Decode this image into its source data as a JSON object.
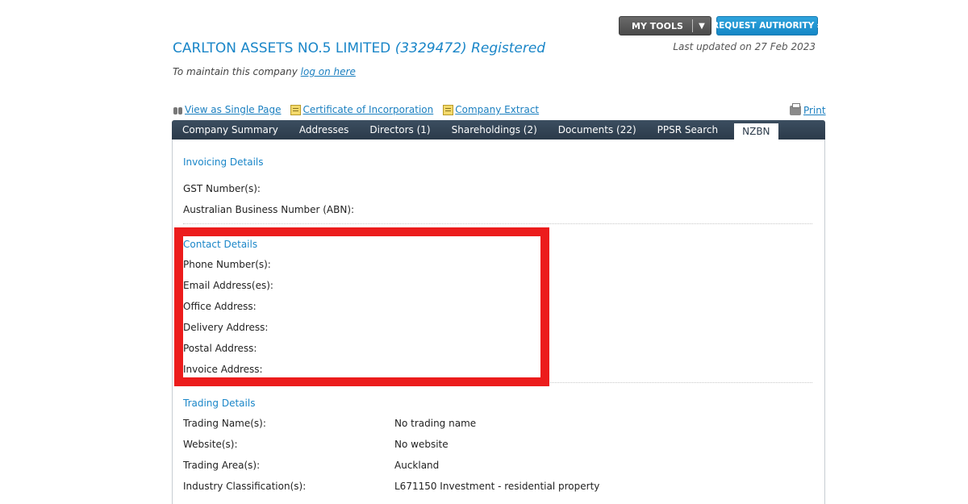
{
  "top_buttons": {
    "my_tools": "MY TOOLS",
    "dropdown_glyph": "▼",
    "request_authority": "REQUEST AUTHORITY",
    "request_chevron": "»"
  },
  "company": {
    "name": "CARLTON ASSETS NO.5 LIMITED",
    "number": "(3329472)",
    "status": "Registered",
    "last_updated": "Last updated on 27 Feb 2023",
    "maintain_text": "To maintain this company",
    "logon_link": "log on here"
  },
  "links": {
    "single_page": "View as Single Page",
    "certificate": "Certificate of Incorporation",
    "extract": "Company Extract",
    "print": "Print"
  },
  "tabs": [
    {
      "label": "Company Summary"
    },
    {
      "label": "Addresses"
    },
    {
      "label": "Directors (1)"
    },
    {
      "label": "Shareholdings (2)"
    },
    {
      "label": "Documents (22)"
    },
    {
      "label": "PPSR Search"
    },
    {
      "label": "NZBN",
      "active": true
    }
  ],
  "invoicing": {
    "heading": "Invoicing Details",
    "gst": "GST Number(s):",
    "abn": "Australian Business Number (ABN):"
  },
  "contact": {
    "heading": "Contact Details",
    "phone": "Phone Number(s):",
    "email": "Email Address(es):",
    "office": "Office Address:",
    "delivery": "Delivery Address:",
    "postal": "Postal Address:",
    "invoice": "Invoice Address:"
  },
  "trading": {
    "heading": "Trading Details",
    "rows": [
      {
        "label": "Trading Name(s):",
        "value": "No trading name"
      },
      {
        "label": "Website(s):",
        "value": "No website"
      },
      {
        "label": "Trading Area(s):",
        "value": "Auckland"
      },
      {
        "label": "Industry Classification(s):",
        "value": "L671150 Investment - residential property"
      }
    ]
  },
  "colors": {
    "accent_blue": "#1a86c8",
    "tab_bar": "#2b3a4a",
    "highlight_red": "#ec1c1c"
  }
}
